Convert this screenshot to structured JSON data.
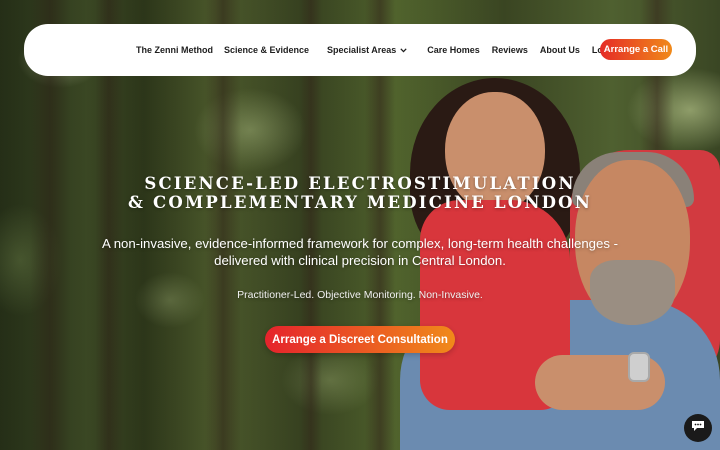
{
  "nav": {
    "items": [
      {
        "label": "The Zenni Method"
      },
      {
        "label": "Science & Evidence"
      },
      {
        "label": "Specialist Areas",
        "has_dropdown": true
      },
      {
        "label": "Care Homes"
      },
      {
        "label": "Reviews"
      },
      {
        "label": "About Us"
      },
      {
        "label": "Locations"
      }
    ],
    "cta_label": "Arrange a Call",
    "dropdown_icon": "chevron-down-icon"
  },
  "hero": {
    "title_line1": "SCIENCE-LED ELECTROSTIMULATION",
    "title_line2": "& COMPLEMENTARY MEDICINE LONDON",
    "subtitle_line1": "A non-invasive, evidence-informed framework for complex, long-term health challenges -",
    "subtitle_line2": "delivered with clinical precision in Central London.",
    "tagline": "Practitioner-Led. Objective Monitoring. Non-Invasive.",
    "cta_label": "Arrange a Discreet Consultation"
  },
  "chat": {
    "icon": "chat-bubble-icon"
  },
  "colors": {
    "cta_gradient_start": "#e52b26",
    "cta_gradient_end": "#f08a1a",
    "nav_background": "#ffffff",
    "nav_text": "#1e1e1e"
  }
}
